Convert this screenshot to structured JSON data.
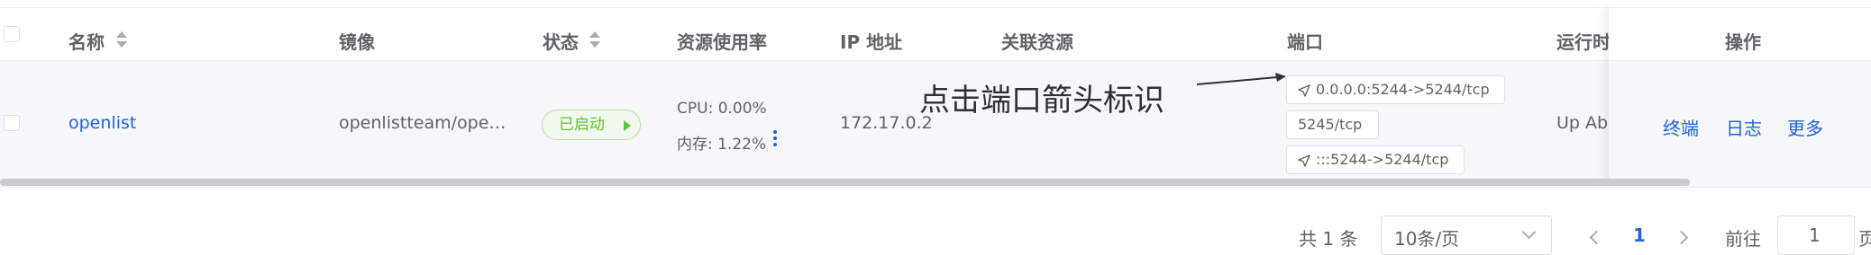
{
  "table": {
    "columns": {
      "name": "名称",
      "image": "镜像",
      "status": "状态",
      "usage": "资源使用率",
      "ip": "IP 地址",
      "related": "关联资源",
      "ports": "端口",
      "runtime": "运行时",
      "actions": "操作"
    },
    "rows": [
      {
        "name": "openlist",
        "image": "openlistteam/ope…",
        "status": "已启动",
        "cpu": "CPU: 0.00%",
        "mem": "内存: 1.22%",
        "ip": "172.17.0.2",
        "ports": [
          "0.0.0.0:5244->5244/tcp",
          "5245/tcp",
          ":::5244->5244/tcp"
        ],
        "runtime": "Up Abo",
        "actions": [
          "终端",
          "日志",
          "更多"
        ]
      }
    ]
  },
  "annotation": {
    "text": "点击端口箭头标识"
  },
  "pagination": {
    "total": "共 1 条",
    "page_size": "10条/页",
    "current_page": "1",
    "goto_label": "前往",
    "goto_value": "1",
    "page_suffix": "页"
  },
  "colors": {
    "accent": "#1f63d9",
    "success": "#67c23a",
    "row_bg": "#f5f7fa",
    "border": "#dcdfe6"
  },
  "icons": [
    "sort-icon",
    "play-icon",
    "more-vertical-icon",
    "navigation-arrow-icon",
    "chevron-down-icon",
    "chevron-left-icon",
    "chevron-right-icon"
  ]
}
